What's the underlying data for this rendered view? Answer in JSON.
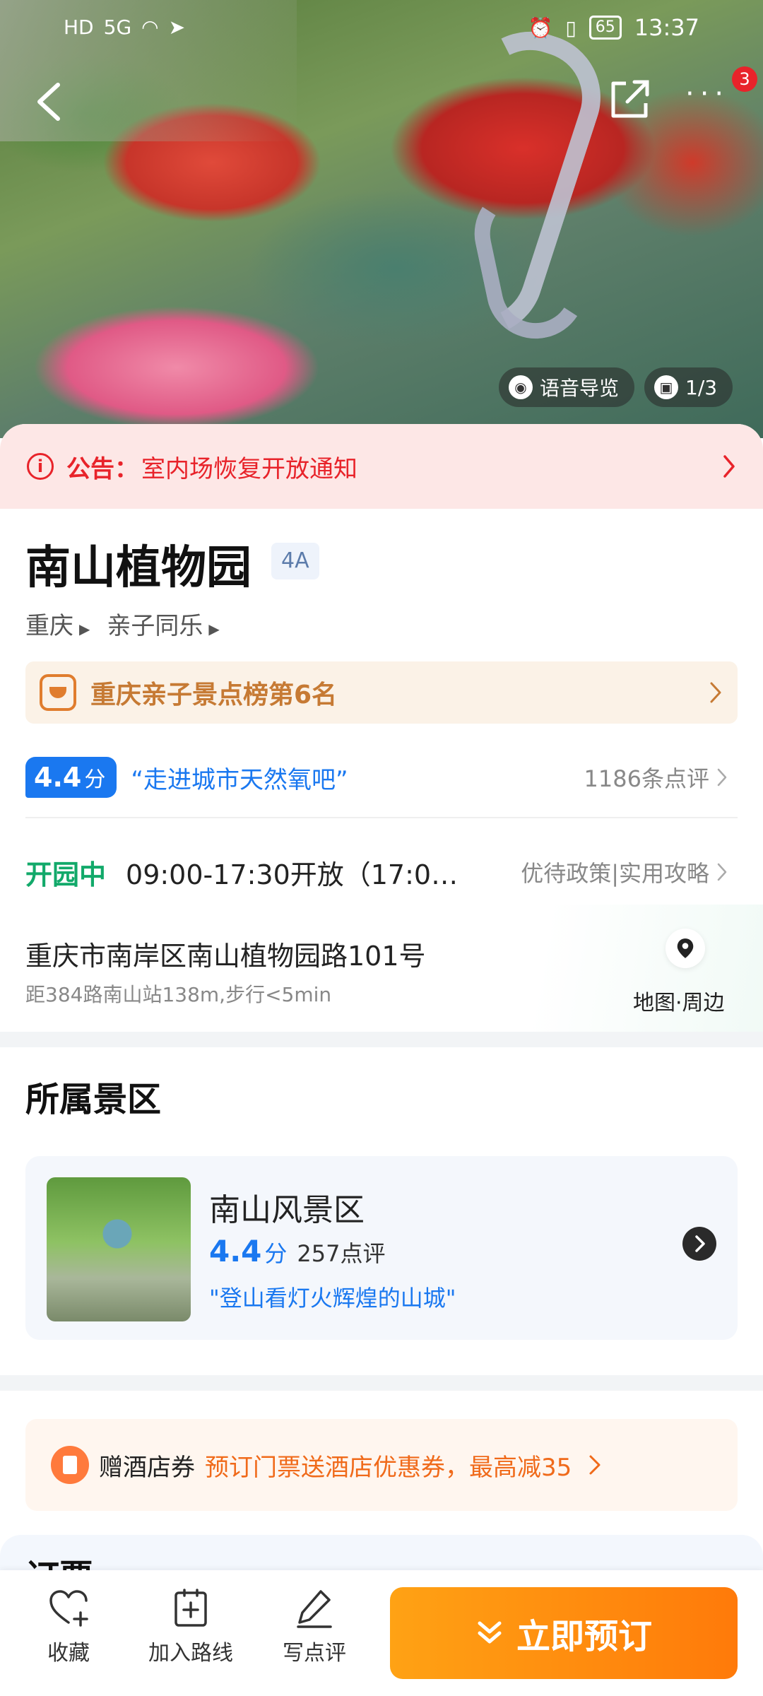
{
  "status_bar": {
    "left": [
      "HD",
      "5G",
      "wifi",
      "send"
    ],
    "battery": "65",
    "time": "13:37"
  },
  "nav": {
    "back_icon": "chevron-left-icon",
    "share_icon": "share-icon",
    "more_icon": "more-dots-icon",
    "notification_count": "3"
  },
  "hero": {
    "audio_guide_label": "语音导览",
    "photo_counter": "1/3"
  },
  "notice": {
    "label": "公告：",
    "text": "室内场恢复开放通知"
  },
  "attraction": {
    "name": "南山植物园",
    "grade": "4A",
    "tags": [
      "重庆",
      "亲子同乐"
    ],
    "ranking": "重庆亲子景点榜第6名",
    "score": "4.4",
    "score_unit": "分",
    "quote": "“走进城市天然氧吧”",
    "review_count": "1186条点评",
    "open_status": "开园中",
    "hours": "09:00-17:30开放（17:0…",
    "policy_links": "优待政策|实用攻略",
    "address": "重庆市南岸区南山植物园路101号",
    "distance": "距384路南山站138m,步行<5min",
    "map_link": "地图·周边"
  },
  "scenic_area": {
    "section_title": "所属景区",
    "name": "南山风景区",
    "score": "4.4",
    "score_unit": "分",
    "review_count": "257点评",
    "quote": "\"登山看灯火辉煌的山城\""
  },
  "coupon": {
    "label": "赠酒店券",
    "description": "预订门票送酒店优惠券，最高减35"
  },
  "next_section_peek": "订票",
  "bottom_bar": {
    "favorite": "收藏",
    "add_route": "加入路线",
    "write_review": "写点评",
    "book_now": "立即预订"
  },
  "colors": {
    "accent_blue": "#1a78f0",
    "notice_red": "#e8232a",
    "open_green": "#12a96a",
    "book_orange": "#ff8a0a"
  }
}
